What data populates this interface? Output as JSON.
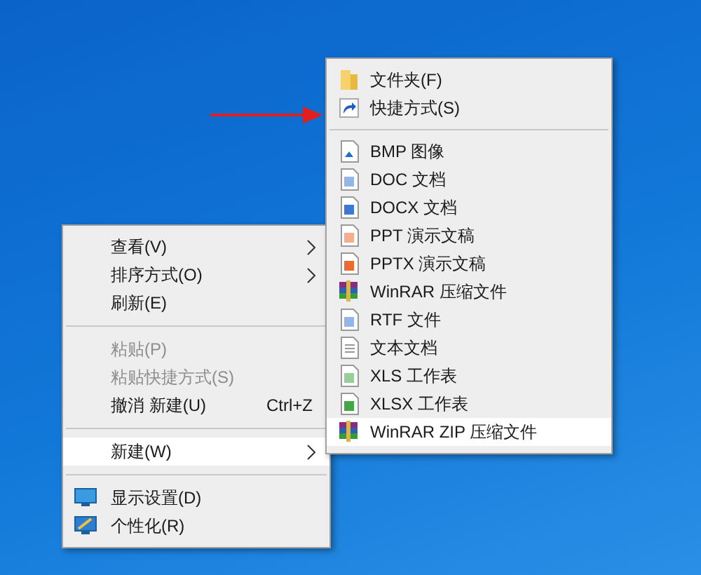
{
  "context_menu": {
    "items": [
      {
        "kind": "item",
        "label": "查看(V)",
        "submenu": true,
        "disabled": false,
        "selected": false
      },
      {
        "kind": "item",
        "label": "排序方式(O)",
        "submenu": true,
        "disabled": false,
        "selected": false
      },
      {
        "kind": "item",
        "label": "刷新(E)",
        "submenu": false,
        "disabled": false,
        "selected": false
      },
      {
        "kind": "separator"
      },
      {
        "kind": "item",
        "label": "粘贴(P)",
        "submenu": false,
        "disabled": true,
        "selected": false
      },
      {
        "kind": "item",
        "label": "粘贴快捷方式(S)",
        "submenu": false,
        "disabled": true,
        "selected": false
      },
      {
        "kind": "item",
        "label": "撤消 新建(U)",
        "shortcut": "Ctrl+Z",
        "submenu": false,
        "disabled": false,
        "selected": false
      },
      {
        "kind": "separator"
      },
      {
        "kind": "item",
        "label": "新建(W)",
        "submenu": true,
        "disabled": false,
        "selected": true
      },
      {
        "kind": "separator"
      },
      {
        "kind": "display",
        "label": "显示设置(D)",
        "submenu": false,
        "disabled": false,
        "selected": false
      },
      {
        "kind": "personalize",
        "label": "个性化(R)",
        "submenu": false,
        "disabled": false,
        "selected": false
      }
    ]
  },
  "new_submenu": {
    "items": [
      {
        "kind": "folder",
        "label": "文件夹(F)",
        "selected": false
      },
      {
        "kind": "shortcut",
        "label": "快捷方式(S)",
        "selected": false
      },
      {
        "kind": "separator"
      },
      {
        "kind": "bmp",
        "label": "BMP 图像",
        "selected": false
      },
      {
        "kind": "doc",
        "label": "DOC 文档",
        "selected": false
      },
      {
        "kind": "docx",
        "label": "DOCX 文档",
        "selected": false
      },
      {
        "kind": "ppt",
        "label": "PPT 演示文稿",
        "selected": false
      },
      {
        "kind": "pptx",
        "label": "PPTX 演示文稿",
        "selected": false
      },
      {
        "kind": "rar",
        "label": "WinRAR 压缩文件",
        "selected": false
      },
      {
        "kind": "rtf",
        "label": "RTF 文件",
        "selected": false
      },
      {
        "kind": "txt",
        "label": "文本文档",
        "selected": false
      },
      {
        "kind": "xls",
        "label": "XLS 工作表",
        "selected": false
      },
      {
        "kind": "xlsx",
        "label": "XLSX 工作表",
        "selected": false
      },
      {
        "kind": "rar",
        "label": "WinRAR ZIP 压缩文件",
        "selected": true
      }
    ]
  }
}
